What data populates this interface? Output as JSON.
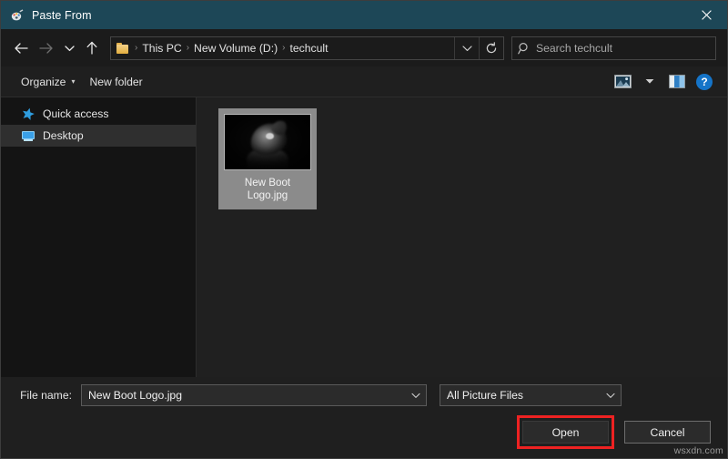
{
  "window": {
    "title": "Paste From",
    "title_icon": "paint-app-icon",
    "close_icon": "close-icon",
    "titlebar_color": "#1d4757"
  },
  "nav": {
    "back_icon": "back-arrow-icon",
    "forward_icon": "forward-arrow-icon",
    "recent_icon": "chevron-down-icon",
    "up_icon": "up-arrow-icon",
    "address": {
      "folder_icon": "folder-icon",
      "crumbs": [
        "This PC",
        "New Volume (D:)",
        "techcult"
      ],
      "separator": "›",
      "history_icon": "chevron-down-icon",
      "refresh_icon": "refresh-icon"
    },
    "search": {
      "icon": "search-icon",
      "placeholder": "Search techcult",
      "value": ""
    }
  },
  "toolbar": {
    "organize_label": "Organize",
    "organize_caret": "▾",
    "new_folder_label": "New folder",
    "view_icon": "picture-view-icon",
    "view_caret_icon": "chevron-down-icon",
    "preview_pane_icon": "preview-pane-icon",
    "help_icon": "help-icon",
    "help_glyph": "?"
  },
  "sidebar": {
    "items": [
      {
        "label": "Quick access",
        "icon": "star-icon",
        "selected": false
      },
      {
        "label": "Desktop",
        "icon": "monitor-icon",
        "selected": true
      }
    ]
  },
  "files": {
    "items": [
      {
        "name": "New Boot Logo.jpg",
        "line1": "New Boot",
        "line2": "Logo.jpg",
        "thumbnail": "dark-cat-photo-thumbnail",
        "selected": true
      }
    ]
  },
  "footer": {
    "filename_label": "File name:",
    "filename_value": "New Boot Logo.jpg",
    "filename_caret_icon": "chevron-down-icon",
    "filter_value": "All Picture Files",
    "filter_caret_icon": "chevron-down-icon",
    "open_label": "Open",
    "cancel_label": "Cancel",
    "open_highlight_color": "#ee2222"
  },
  "watermark": {
    "text": "wsxdn.com"
  }
}
